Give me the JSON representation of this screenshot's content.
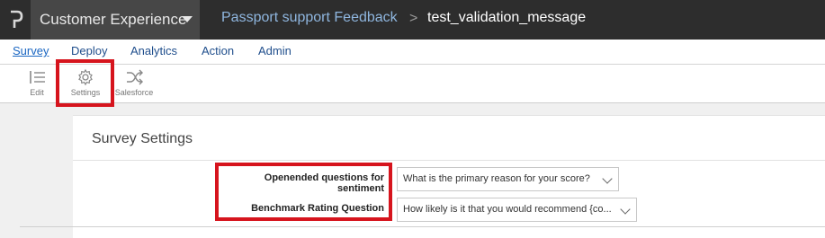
{
  "header": {
    "logo_letter": "P",
    "product_name": "Customer Experience",
    "breadcrumb_project": "Passport support Feedback",
    "breadcrumb_separator": ">",
    "breadcrumb_survey": "test_validation_message"
  },
  "nav": {
    "tabs": [
      "Survey",
      "Deploy",
      "Analytics",
      "Action",
      "Admin"
    ],
    "active_tab": "Survey"
  },
  "toolbar": {
    "edit_label": "Edit",
    "settings_label": "Settings",
    "salesforce_label": "Salesforce"
  },
  "settings": {
    "title": "Survey Settings",
    "rows": [
      {
        "label": "Openended questions for sentiment",
        "value": "What is the primary reason for your score?"
      },
      {
        "label": "Benchmark Rating Question",
        "value": "How likely is it that you would recommend {co..."
      }
    ]
  },
  "colors": {
    "highlight": "#d6141d",
    "topbar": "#2d2d2d",
    "link": "#1f4e8c"
  },
  "icons": [
    "logo-icon",
    "chevron-down-icon",
    "edit-list-icon",
    "gear-icon",
    "shuffle-icon"
  ]
}
